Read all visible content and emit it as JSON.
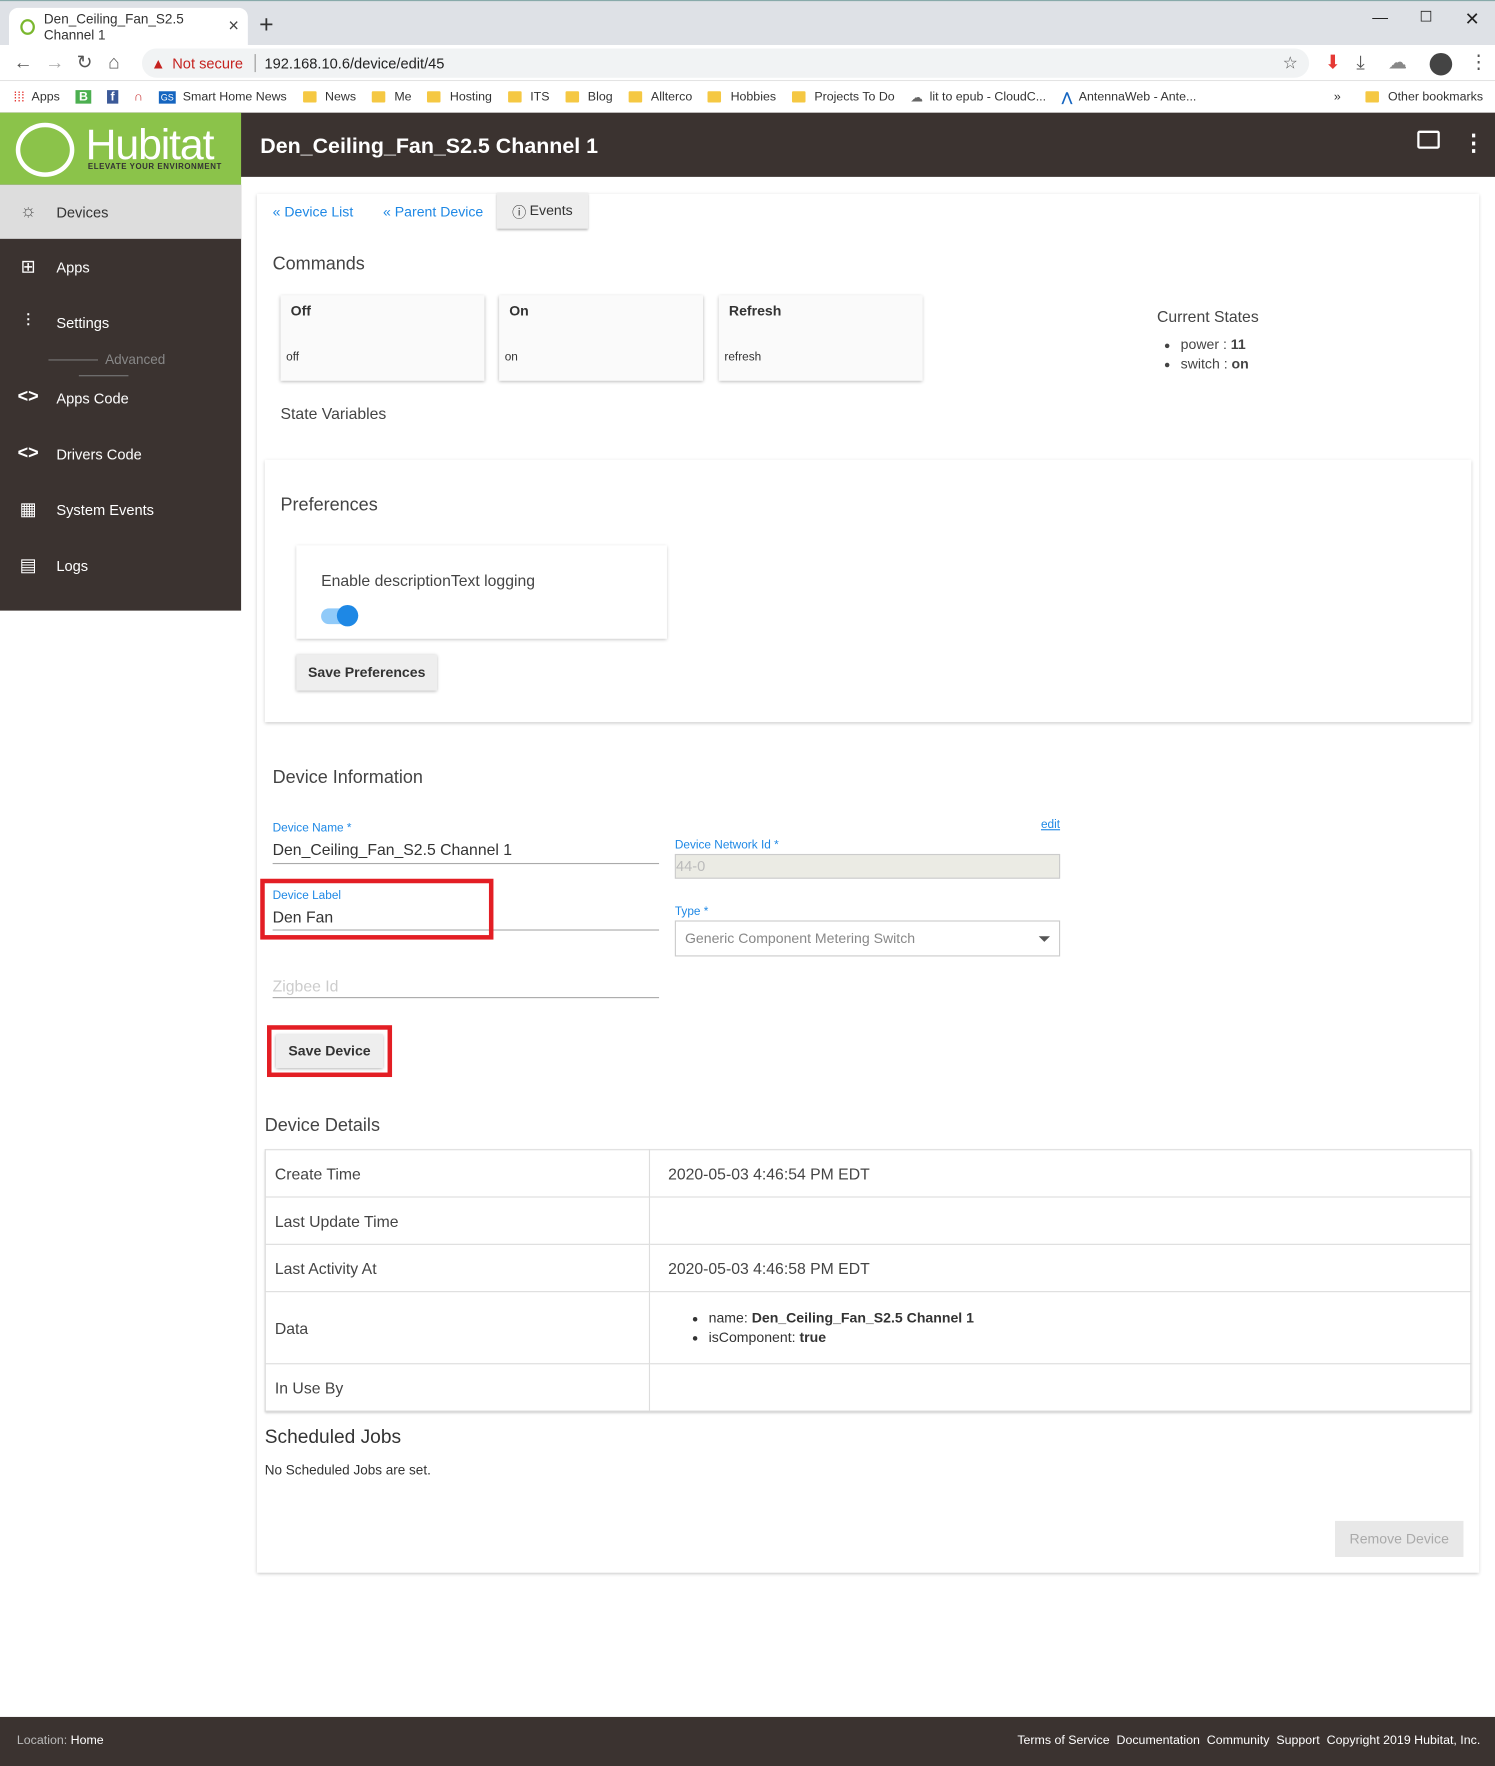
{
  "browser": {
    "tab_title": "Den_Ceiling_Fan_S2.5 Channel 1",
    "security_warning": "Not secure",
    "url": "192.168.10.6/device/edit/45",
    "bookmarks": [
      "Apps",
      "Smart Home News",
      "News",
      "Me",
      "Hosting",
      "ITS",
      "Blog",
      "Allterco",
      "Hobbies",
      "Projects To Do",
      "lit to epub - CloudC...",
      "AntennaWeb - Ante..."
    ],
    "other_bookmarks": "Other bookmarks"
  },
  "header": {
    "brand": "Hubitat",
    "tagline": "ELEVATE YOUR ENVIRONMENT",
    "page_title": "Den_Ceiling_Fan_S2.5 Channel 1"
  },
  "sidebar": {
    "items": [
      {
        "label": "Devices",
        "icon": "bulb-icon"
      },
      {
        "label": "Apps",
        "icon": "apps-grid-icon"
      },
      {
        "label": "Settings",
        "icon": "sliders-icon"
      },
      {
        "label": "Apps Code",
        "icon": "code-icon"
      },
      {
        "label": "Drivers Code",
        "icon": "code-icon"
      },
      {
        "label": "System Events",
        "icon": "calendar-icon"
      },
      {
        "label": "Logs",
        "icon": "document-icon"
      }
    ],
    "advanced_label": "Advanced"
  },
  "nav": {
    "device_list": "« Device List",
    "parent_device": "« Parent Device",
    "events": "Events"
  },
  "commands": {
    "title": "Commands",
    "items": [
      {
        "label": "Off",
        "sub": "off"
      },
      {
        "label": "On",
        "sub": "on"
      },
      {
        "label": "Refresh",
        "sub": "refresh"
      }
    ]
  },
  "current_states": {
    "title": "Current States",
    "power_key": "power : ",
    "power_val": "11",
    "switch_key": "switch : ",
    "switch_val": "on"
  },
  "state_variables": "State Variables",
  "preferences": {
    "title": "Preferences",
    "toggle_label": "Enable descriptionText logging",
    "toggle_on": true,
    "save_label": "Save Preferences"
  },
  "device_info": {
    "title": "Device Information",
    "name_label": "Device Name *",
    "name_value": "Den_Ceiling_Fan_S2.5 Channel 1",
    "edit_link": "edit",
    "network_id_label": "Device Network Id *",
    "network_id_value": "44-0",
    "label_label": "Device Label",
    "label_value": "Den Fan",
    "type_label": "Type *",
    "type_value": "Generic Component Metering Switch",
    "zigbee_placeholder": "Zigbee Id",
    "save_label": "Save Device"
  },
  "device_details": {
    "title": "Device Details",
    "create_time_key": "Create Time",
    "create_time_val": "2020-05-03 4:46:54 PM EDT",
    "last_update_key": "Last Update Time",
    "last_update_val": "",
    "last_activity_key": "Last Activity At",
    "last_activity_val": "2020-05-03 4:46:58 PM EDT",
    "data_key": "Data",
    "data_name_key": "name: ",
    "data_name_val": "Den_Ceiling_Fan_S2.5 Channel 1",
    "data_comp_key": "isComponent: ",
    "data_comp_val": "true",
    "in_use_key": "In Use By",
    "in_use_val": ""
  },
  "scheduled_jobs": {
    "title": "Scheduled Jobs",
    "empty": "No Scheduled Jobs are set."
  },
  "remove_label": "Remove Device",
  "footer": {
    "location_key": "Location: ",
    "location_val": "Home",
    "links": [
      "Terms of Service",
      "Documentation",
      "Community",
      "Support"
    ],
    "copyright": "Copyright 2019 Hubitat, Inc."
  },
  "colors": {
    "brand_green": "#8bc34a",
    "header_dark": "#3b3330",
    "link_blue": "#1e88e5",
    "highlight_red": "#e31e24"
  }
}
